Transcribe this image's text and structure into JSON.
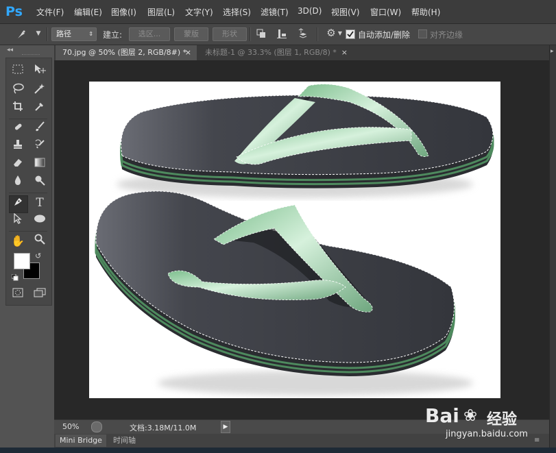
{
  "app": {
    "logo": "Ps"
  },
  "menu": [
    "文件(F)",
    "编辑(E)",
    "图像(I)",
    "图层(L)",
    "文字(Y)",
    "选择(S)",
    "滤镜(T)",
    "3D(D)",
    "视图(V)",
    "窗口(W)",
    "帮助(H)"
  ],
  "options": {
    "mode_value": "路径",
    "make_label": "建立:",
    "selection_btn": "选区...",
    "mask_btn": "蒙版",
    "shape_btn": "形状",
    "auto_add_delete": "自动添加/删除",
    "align_edges": "对齐边缘"
  },
  "tabs": [
    {
      "label": "70.jpg @ 50% (图层 2, RGB/8#) *",
      "active": true
    },
    {
      "label": "未标题-1 @ 33.3% (图层 1, RGB/8) *",
      "active": false
    }
  ],
  "status": {
    "zoom": "50%",
    "doc_size": "文档:3.18M/11.0M"
  },
  "bottom_tabs": [
    "Mini Bridge",
    "时间轴"
  ],
  "watermark": {
    "brand": "Bai",
    "brand2": "经验",
    "url": "jingyan.baidu.com"
  },
  "icons": {
    "pen": "pen-icon",
    "marquee": "rect-marquee-icon",
    "move": "move-icon",
    "lasso": "lasso-icon",
    "wand": "magic-wand-icon",
    "crop": "crop-icon",
    "eyedropper": "eyedropper-icon",
    "heal": "healing-brush-icon",
    "brush": "brush-icon",
    "stamp": "clone-stamp-icon",
    "history_brush": "history-brush-icon",
    "eraser": "eraser-icon",
    "gradient": "gradient-icon",
    "blur": "blur-icon",
    "dodge": "dodge-icon",
    "text": "type-icon",
    "path_select": "path-selection-icon",
    "ellipse": "ellipse-icon",
    "hand": "hand-icon",
    "zoom": "zoom-icon",
    "gear": "gear-icon"
  },
  "colors": {
    "accent": "#31a8ff",
    "strap": "#9fd6ad",
    "sole": "#3c3e45",
    "stripe": "#4e8a5e"
  }
}
